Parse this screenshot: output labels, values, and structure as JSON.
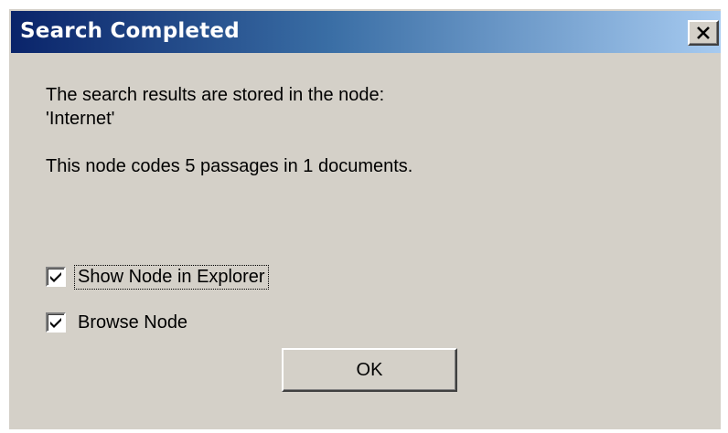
{
  "window": {
    "title": "Search Completed",
    "close_icon": "close-x-icon",
    "title_gradient": [
      "#0a246a",
      "#a6caf0"
    ],
    "face_color": "#d4d0c8"
  },
  "message": {
    "line1": "The search results are stored in the node:",
    "line2": "'Internet'",
    "line3": "This node codes 5 passages in 1 documents."
  },
  "options": [
    {
      "label": "Show Node in Explorer",
      "checked": true,
      "focused": true
    },
    {
      "label": "Browse Node",
      "checked": true,
      "focused": false
    }
  ],
  "buttons": {
    "ok_label": "OK"
  }
}
